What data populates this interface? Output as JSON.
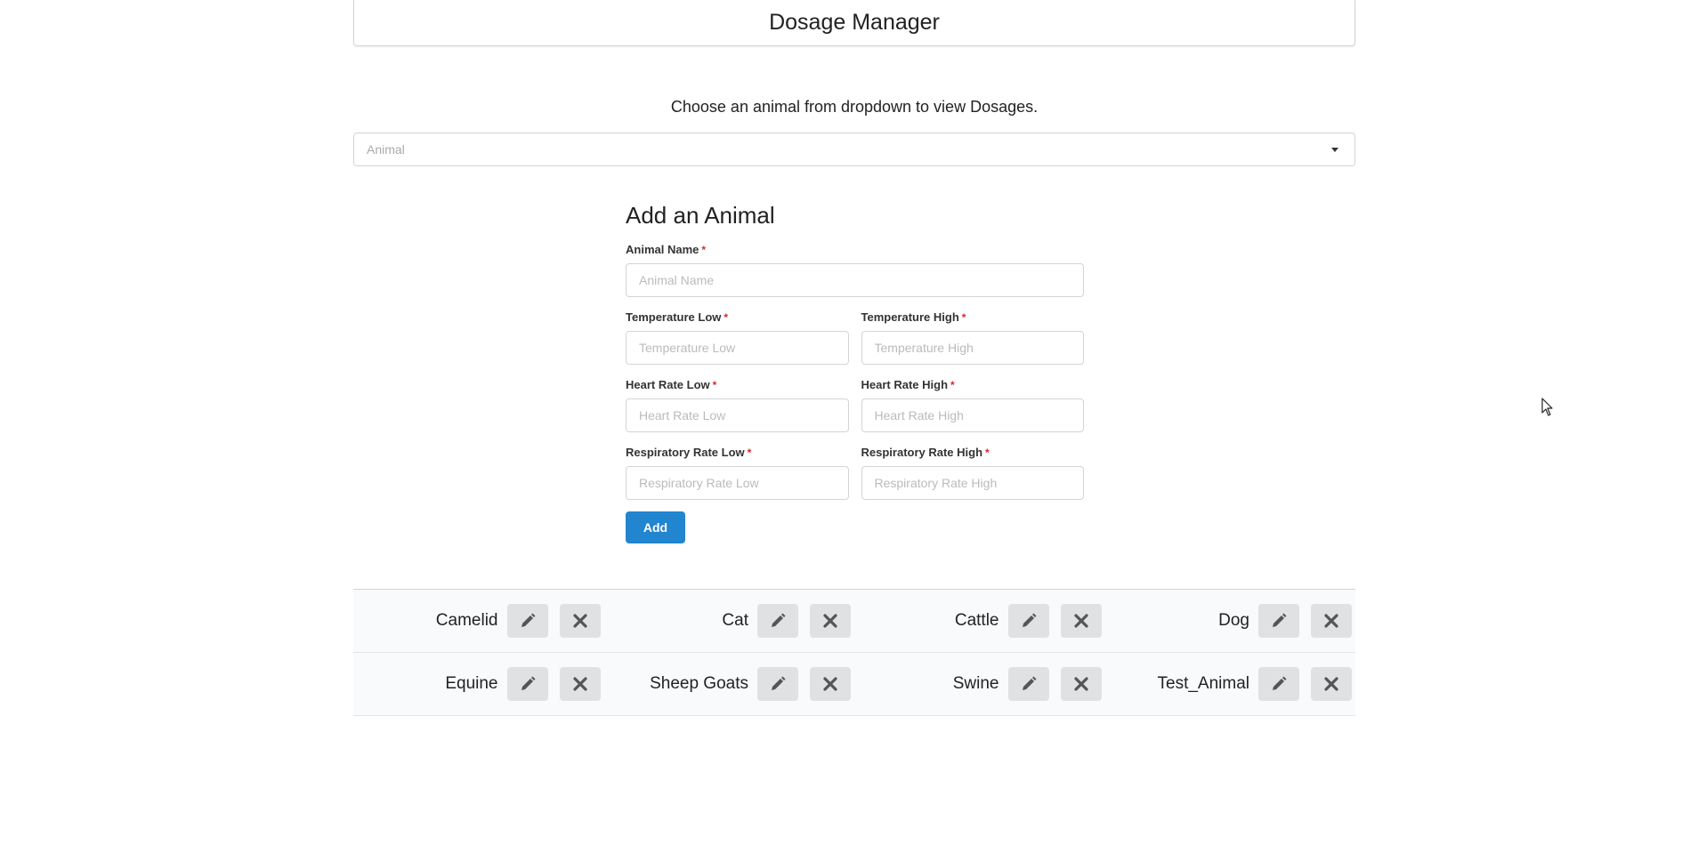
{
  "header": {
    "title": "Dosage Manager"
  },
  "instruction": "Choose an animal from dropdown to view Dosages.",
  "dropdown": {
    "placeholder": "Animal"
  },
  "form": {
    "title": "Add an Animal",
    "required_mark": "*",
    "animal_name": {
      "label": "Animal Name",
      "placeholder": "Animal Name",
      "value": ""
    },
    "temperature_low": {
      "label": "Temperature Low",
      "placeholder": "Temperature Low",
      "value": ""
    },
    "temperature_high": {
      "label": "Temperature High",
      "placeholder": "Temperature High",
      "value": ""
    },
    "heart_rate_low": {
      "label": "Heart Rate Low",
      "placeholder": "Heart Rate Low",
      "value": ""
    },
    "heart_rate_high": {
      "label": "Heart Rate High",
      "placeholder": "Heart Rate High",
      "value": ""
    },
    "resp_rate_low": {
      "label": "Respiratory Rate Low",
      "placeholder": "Respiratory Rate Low",
      "value": ""
    },
    "resp_rate_high": {
      "label": "Respiratory Rate High",
      "placeholder": "Respiratory Rate High",
      "value": ""
    },
    "add_label": "Add",
    "add_color": "#2185d0"
  },
  "animals": [
    {
      "name": "Camelid",
      "edit_icon": "pencil-icon",
      "delete_icon": "close-icon"
    },
    {
      "name": "Cat",
      "edit_icon": "pencil-icon",
      "delete_icon": "close-icon"
    },
    {
      "name": "Cattle",
      "edit_icon": "pencil-icon",
      "delete_icon": "close-icon"
    },
    {
      "name": "Dog",
      "edit_icon": "pencil-icon",
      "delete_icon": "close-icon"
    },
    {
      "name": "Equine",
      "edit_icon": "pencil-icon",
      "delete_icon": "close-icon"
    },
    {
      "name": "Sheep Goats",
      "edit_icon": "pencil-icon",
      "delete_icon": "close-icon"
    },
    {
      "name": "Swine",
      "edit_icon": "pencil-icon",
      "delete_icon": "close-icon"
    },
    {
      "name": "Test_Animal",
      "edit_icon": "pencil-icon",
      "delete_icon": "close-icon"
    }
  ]
}
